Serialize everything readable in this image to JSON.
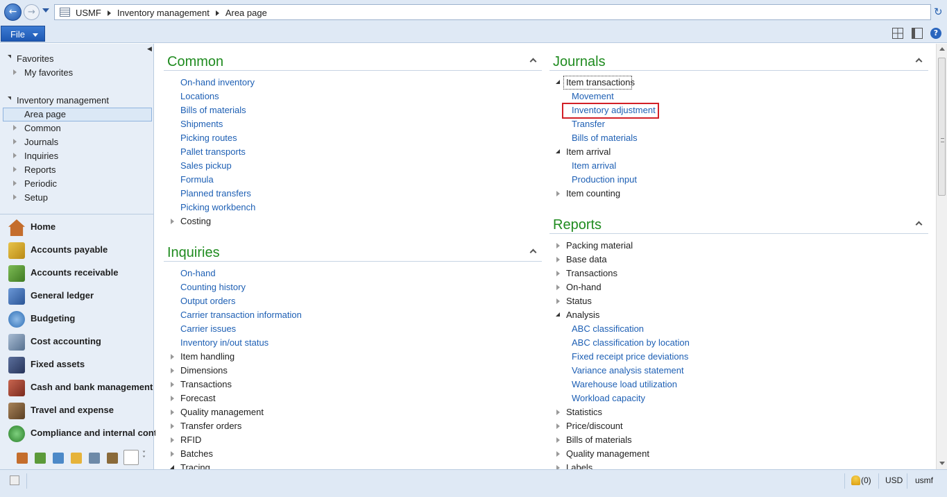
{
  "address": {
    "crumbs": [
      "USMF",
      "Inventory management",
      "Area page"
    ]
  },
  "menubar": {
    "file_label": "File"
  },
  "navpane": {
    "favorites_label": "Favorites",
    "my_favorites_label": "My favorites",
    "module_label": "Inventory management",
    "area_page_label": "Area page",
    "tree_items": [
      "Common",
      "Journals",
      "Inquiries",
      "Reports",
      "Periodic",
      "Setup"
    ],
    "modules": [
      {
        "label": "Home",
        "icon": "home-icon",
        "color": "#c46d2c"
      },
      {
        "label": "Accounts payable",
        "icon": "accounts-payable-icon",
        "color": "#d9a825"
      },
      {
        "label": "Accounts receivable",
        "icon": "accounts-receivable-icon",
        "color": "#5b9a3a"
      },
      {
        "label": "General ledger",
        "icon": "general-ledger-icon",
        "color": "#3f6fb5"
      },
      {
        "label": "Budgeting",
        "icon": "budgeting-icon",
        "color": "#4c89c8"
      },
      {
        "label": "Cost accounting",
        "icon": "cost-accounting-icon",
        "color": "#6e8aa8"
      },
      {
        "label": "Fixed assets",
        "icon": "fixed-assets-icon",
        "color": "#3d4f7a"
      },
      {
        "label": "Cash and bank management",
        "icon": "cash-bank-icon",
        "color": "#9c3b2e"
      },
      {
        "label": "Travel and expense",
        "icon": "travel-expense-icon",
        "color": "#7a5b3a"
      },
      {
        "label": "Compliance and internal cont...",
        "icon": "compliance-icon",
        "color": "#3a8f3a"
      }
    ]
  },
  "common": {
    "title": "Common",
    "links": [
      "On-hand inventory",
      "Locations",
      "Bills of materials",
      "Shipments",
      "Picking routes",
      "Pallet transports",
      "Sales pickup",
      "Formula",
      "Planned transfers",
      "Picking workbench"
    ],
    "groups": [
      "Costing"
    ]
  },
  "inquiries": {
    "title": "Inquiries",
    "links": [
      "On-hand",
      "Counting history",
      "Output orders",
      "Carrier transaction information",
      "Carrier issues",
      "Inventory in/out status"
    ],
    "groups": [
      "Item handling",
      "Dimensions",
      "Transactions",
      "Forecast",
      "Quality management",
      "Transfer orders",
      "RFID",
      "Batches",
      "Tracing"
    ]
  },
  "journals": {
    "title": "Journals",
    "item_transactions_label": "Item transactions",
    "item_transactions_links": [
      "Movement",
      "Inventory adjustment",
      "Transfer",
      "Bills of materials"
    ],
    "item_arrival_label": "Item arrival",
    "item_arrival_links": [
      "Item arrival",
      "Production input"
    ],
    "item_counting_label": "Item counting"
  },
  "reports": {
    "title": "Reports",
    "groups_before": [
      "Packing material",
      "Base data",
      "Transactions",
      "On-hand",
      "Status"
    ],
    "analysis_label": "Analysis",
    "analysis_links": [
      "ABC classification",
      "ABC classification by location",
      "Fixed receipt price deviations",
      "Variance analysis statement",
      "Warehouse load utilization",
      "Workload capacity"
    ],
    "groups_after": [
      "Statistics",
      "Price/discount",
      "Bills of materials",
      "Quality management",
      "Labels"
    ]
  },
  "statusbar": {
    "notifications": "(0)",
    "currency": "USD",
    "company": "usmf"
  }
}
